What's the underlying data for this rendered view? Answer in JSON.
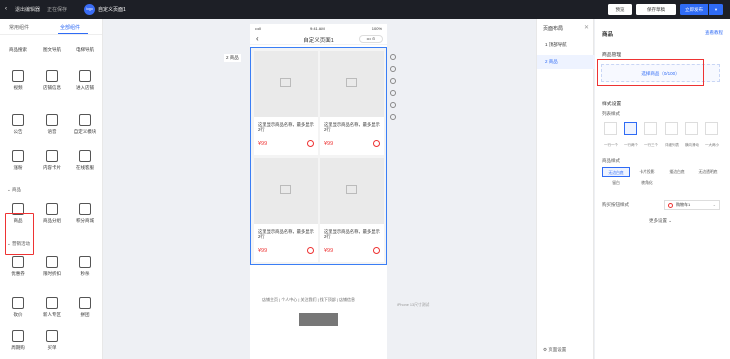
{
  "topbar": {
    "back_label": "‹",
    "exit_label": "退出编辑器",
    "saving_label": "正在保存",
    "logo_text": "logo",
    "page_title": "自定义页面1",
    "preview_label": "预览",
    "save_draft_label": "保存草稿",
    "publish_label": "立即发布",
    "more_label": "▾"
  },
  "left": {
    "tabs": [
      "常用组件",
      "全部组件"
    ],
    "components": [
      {
        "label": "商品搜索",
        "icon": "search-icon"
      },
      {
        "label": "图文导航",
        "icon": "image-icon"
      },
      {
        "label": "电梯导航",
        "icon": "elevator-icon"
      },
      {
        "label": "视频",
        "icon": "video-icon"
      },
      {
        "label": "店铺信息",
        "icon": "store-icon"
      },
      {
        "label": "进入店铺",
        "icon": "enter-store-icon"
      },
      {
        "label": "公告",
        "icon": "notice-icon"
      },
      {
        "label": "语音",
        "icon": "microphone-icon"
      },
      {
        "label": "自定义模块",
        "icon": "custom-icon"
      },
      {
        "label": "涨粉",
        "icon": "follow-icon"
      },
      {
        "label": "内容卡片",
        "icon": "card-icon"
      },
      {
        "label": "在线客服",
        "icon": "headset-icon"
      }
    ],
    "section_goods": "商品",
    "goods_components": [
      {
        "label": "商品",
        "icon": "shopping-bag-icon"
      },
      {
        "label": "商品分组",
        "icon": "goods-group-icon"
      },
      {
        "label": "积分商城",
        "icon": "points-mall-icon"
      }
    ],
    "section_marketing": "营销活动",
    "marketing_components": [
      {
        "label": "优惠券",
        "icon": "coupon-icon"
      },
      {
        "label": "限时折扣",
        "icon": "discount-icon"
      },
      {
        "label": "秒杀",
        "icon": "flash-sale-icon"
      },
      {
        "label": "砍价",
        "icon": "bargain-icon"
      },
      {
        "label": "新人专区",
        "icon": "newcomer-icon"
      },
      {
        "label": "拼团",
        "icon": "group-buy-icon"
      },
      {
        "label": "周期购",
        "icon": "cycle-buy-icon"
      },
      {
        "label": "买单",
        "icon": "pay-icon"
      }
    ]
  },
  "phone": {
    "signal": "•••ll",
    "time": "9:41 AM",
    "battery": "100%",
    "page_title": "自定义页面1",
    "capsule": "••• ⊙",
    "goods_tag": "2 商品",
    "products": [
      {
        "name": "这里显示商品名称，最多显示2行",
        "price": "¥99"
      },
      {
        "name": "这里显示商品名称，最多显示2行",
        "price": "¥99"
      },
      {
        "name": "这里显示商品名称，最多显示2行",
        "price": "¥99"
      },
      {
        "name": "这里显示商品名称，最多显示2行",
        "price": "¥99"
      }
    ],
    "footer_links": "店铺主页 | 个人中心 | 关注我们 | 找下顶部 | 店铺信息",
    "iphone_note": "iPhone 13尺寸测试"
  },
  "layers": {
    "title": "页面布局",
    "close": "✕",
    "items": [
      "1 顶部导航",
      "2 商品"
    ],
    "page_settings": "页面设置"
  },
  "right": {
    "title": "商品",
    "help_link": "查看教程",
    "goods_manage": "商品管理",
    "select_goods": "选择商品（0/100）",
    "style_settings": "样式设置",
    "list_style_label": "列表样式",
    "list_styles": [
      "一行一个",
      "一行两个",
      "一行三个",
      "详细列表",
      "横向滑动",
      "一大两小"
    ],
    "goods_style_label": "商品样式",
    "goods_styles": [
      "无边白底",
      "卡片投影",
      "描边白底",
      "无边透明底",
      "留白",
      "棱角化"
    ],
    "buy_button_label": "购买按钮样式",
    "buy_button_value": "购物车1",
    "more_settings": "更多设置 ⌄"
  }
}
